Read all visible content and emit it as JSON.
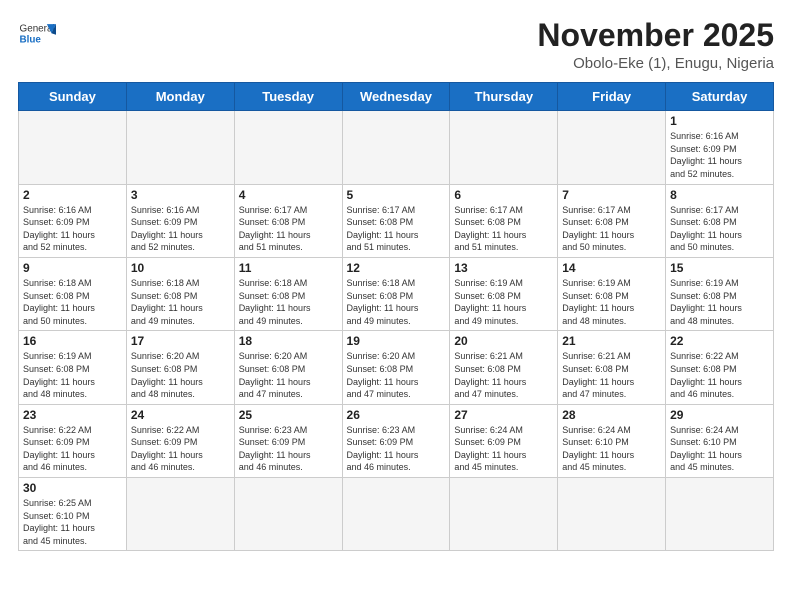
{
  "header": {
    "logo_general": "General",
    "logo_blue": "Blue",
    "month_title": "November 2025",
    "location": "Obolo-Eke (1), Enugu, Nigeria"
  },
  "weekdays": [
    "Sunday",
    "Monday",
    "Tuesday",
    "Wednesday",
    "Thursday",
    "Friday",
    "Saturday"
  ],
  "weeks": [
    [
      {
        "day": "",
        "info": ""
      },
      {
        "day": "",
        "info": ""
      },
      {
        "day": "",
        "info": ""
      },
      {
        "day": "",
        "info": ""
      },
      {
        "day": "",
        "info": ""
      },
      {
        "day": "",
        "info": ""
      },
      {
        "day": "1",
        "info": "Sunrise: 6:16 AM\nSunset: 6:09 PM\nDaylight: 11 hours\nand 52 minutes."
      }
    ],
    [
      {
        "day": "2",
        "info": "Sunrise: 6:16 AM\nSunset: 6:09 PM\nDaylight: 11 hours\nand 52 minutes."
      },
      {
        "day": "3",
        "info": "Sunrise: 6:16 AM\nSunset: 6:09 PM\nDaylight: 11 hours\nand 52 minutes."
      },
      {
        "day": "4",
        "info": "Sunrise: 6:17 AM\nSunset: 6:08 PM\nDaylight: 11 hours\nand 51 minutes."
      },
      {
        "day": "5",
        "info": "Sunrise: 6:17 AM\nSunset: 6:08 PM\nDaylight: 11 hours\nand 51 minutes."
      },
      {
        "day": "6",
        "info": "Sunrise: 6:17 AM\nSunset: 6:08 PM\nDaylight: 11 hours\nand 51 minutes."
      },
      {
        "day": "7",
        "info": "Sunrise: 6:17 AM\nSunset: 6:08 PM\nDaylight: 11 hours\nand 50 minutes."
      },
      {
        "day": "8",
        "info": "Sunrise: 6:17 AM\nSunset: 6:08 PM\nDaylight: 11 hours\nand 50 minutes."
      }
    ],
    [
      {
        "day": "9",
        "info": "Sunrise: 6:18 AM\nSunset: 6:08 PM\nDaylight: 11 hours\nand 50 minutes."
      },
      {
        "day": "10",
        "info": "Sunrise: 6:18 AM\nSunset: 6:08 PM\nDaylight: 11 hours\nand 49 minutes."
      },
      {
        "day": "11",
        "info": "Sunrise: 6:18 AM\nSunset: 6:08 PM\nDaylight: 11 hours\nand 49 minutes."
      },
      {
        "day": "12",
        "info": "Sunrise: 6:18 AM\nSunset: 6:08 PM\nDaylight: 11 hours\nand 49 minutes."
      },
      {
        "day": "13",
        "info": "Sunrise: 6:19 AM\nSunset: 6:08 PM\nDaylight: 11 hours\nand 49 minutes."
      },
      {
        "day": "14",
        "info": "Sunrise: 6:19 AM\nSunset: 6:08 PM\nDaylight: 11 hours\nand 48 minutes."
      },
      {
        "day": "15",
        "info": "Sunrise: 6:19 AM\nSunset: 6:08 PM\nDaylight: 11 hours\nand 48 minutes."
      }
    ],
    [
      {
        "day": "16",
        "info": "Sunrise: 6:19 AM\nSunset: 6:08 PM\nDaylight: 11 hours\nand 48 minutes."
      },
      {
        "day": "17",
        "info": "Sunrise: 6:20 AM\nSunset: 6:08 PM\nDaylight: 11 hours\nand 48 minutes."
      },
      {
        "day": "18",
        "info": "Sunrise: 6:20 AM\nSunset: 6:08 PM\nDaylight: 11 hours\nand 47 minutes."
      },
      {
        "day": "19",
        "info": "Sunrise: 6:20 AM\nSunset: 6:08 PM\nDaylight: 11 hours\nand 47 minutes."
      },
      {
        "day": "20",
        "info": "Sunrise: 6:21 AM\nSunset: 6:08 PM\nDaylight: 11 hours\nand 47 minutes."
      },
      {
        "day": "21",
        "info": "Sunrise: 6:21 AM\nSunset: 6:08 PM\nDaylight: 11 hours\nand 47 minutes."
      },
      {
        "day": "22",
        "info": "Sunrise: 6:22 AM\nSunset: 6:08 PM\nDaylight: 11 hours\nand 46 minutes."
      }
    ],
    [
      {
        "day": "23",
        "info": "Sunrise: 6:22 AM\nSunset: 6:09 PM\nDaylight: 11 hours\nand 46 minutes."
      },
      {
        "day": "24",
        "info": "Sunrise: 6:22 AM\nSunset: 6:09 PM\nDaylight: 11 hours\nand 46 minutes."
      },
      {
        "day": "25",
        "info": "Sunrise: 6:23 AM\nSunset: 6:09 PM\nDaylight: 11 hours\nand 46 minutes."
      },
      {
        "day": "26",
        "info": "Sunrise: 6:23 AM\nSunset: 6:09 PM\nDaylight: 11 hours\nand 46 minutes."
      },
      {
        "day": "27",
        "info": "Sunrise: 6:24 AM\nSunset: 6:09 PM\nDaylight: 11 hours\nand 45 minutes."
      },
      {
        "day": "28",
        "info": "Sunrise: 6:24 AM\nSunset: 6:10 PM\nDaylight: 11 hours\nand 45 minutes."
      },
      {
        "day": "29",
        "info": "Sunrise: 6:24 AM\nSunset: 6:10 PM\nDaylight: 11 hours\nand 45 minutes."
      }
    ],
    [
      {
        "day": "30",
        "info": "Sunrise: 6:25 AM\nSunset: 6:10 PM\nDaylight: 11 hours\nand 45 minutes."
      },
      {
        "day": "",
        "info": ""
      },
      {
        "day": "",
        "info": ""
      },
      {
        "day": "",
        "info": ""
      },
      {
        "day": "",
        "info": ""
      },
      {
        "day": "",
        "info": ""
      },
      {
        "day": "",
        "info": ""
      }
    ]
  ]
}
